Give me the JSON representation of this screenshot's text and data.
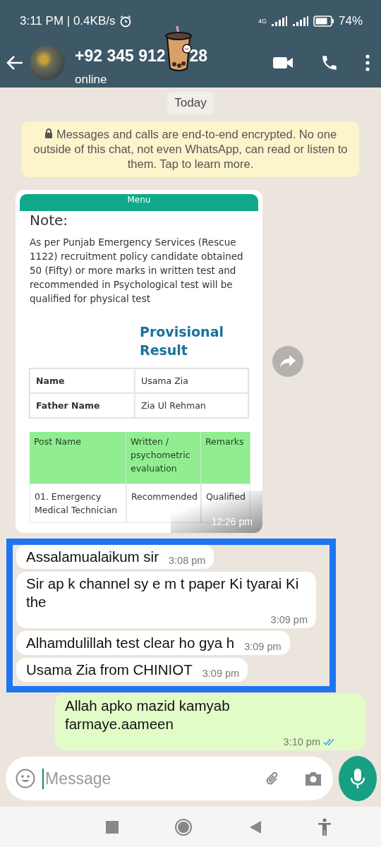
{
  "status_bar": {
    "time": "3:11 PM | 0.4KB/s",
    "network": "4G",
    "battery": "74%"
  },
  "header": {
    "contact_name": "+92 345 912",
    "contact_name_tail": "28",
    "status": "online"
  },
  "date_chip": "Today",
  "encryption_notice": "Messages and calls are end-to-end encrypted. No one outside of this chat, not even WhatsApp, can read or listen to them. Tap to learn more.",
  "image_message": {
    "time": "12:26 pm",
    "screenshot": {
      "menu_bar": "Menu",
      "heading": "Note:",
      "paragraph": "As per Punjab Emergency Services (Rescue 1122) recruitment policy candidate obtained 50 (Fifty) or more marks in written test and recommended in Psychological test will be qualified for physical test",
      "result_title": "Provisional Result",
      "info_rows": [
        {
          "label": "Name",
          "value": "Usama Zia"
        },
        {
          "label": "Father Name",
          "value": "Zia Ul Rehman"
        }
      ],
      "result_table": {
        "columns": [
          "Post Name",
          "Written / psychometric evaluation",
          "Remarks"
        ],
        "rows": [
          [
            "01. Emergency Medical Technician",
            "Recommended",
            "Qualified"
          ]
        ]
      }
    }
  },
  "highlight_frame": {
    "messages": [
      {
        "kind": "incoming",
        "text": "Assalamualaikum sir",
        "time": "3:08 pm"
      },
      {
        "kind": "incoming",
        "text": "Sir ap k channel sy e m t paper Ki tyarai Ki the",
        "time": "3:09 pm"
      },
      {
        "kind": "incoming",
        "text": "Alhamdulillah test clear ho gya h",
        "time": "3:09 pm"
      },
      {
        "kind": "incoming",
        "text": "Usama Zia from CHINIOT",
        "time": "3:09 pm"
      }
    ]
  },
  "messages": [
    {
      "kind": "outgoing",
      "text": "Allah apko mazid kamyab farmaye.aameen",
      "time": "3:10 pm",
      "read": true
    }
  ],
  "composer": {
    "placeholder": "Message"
  }
}
